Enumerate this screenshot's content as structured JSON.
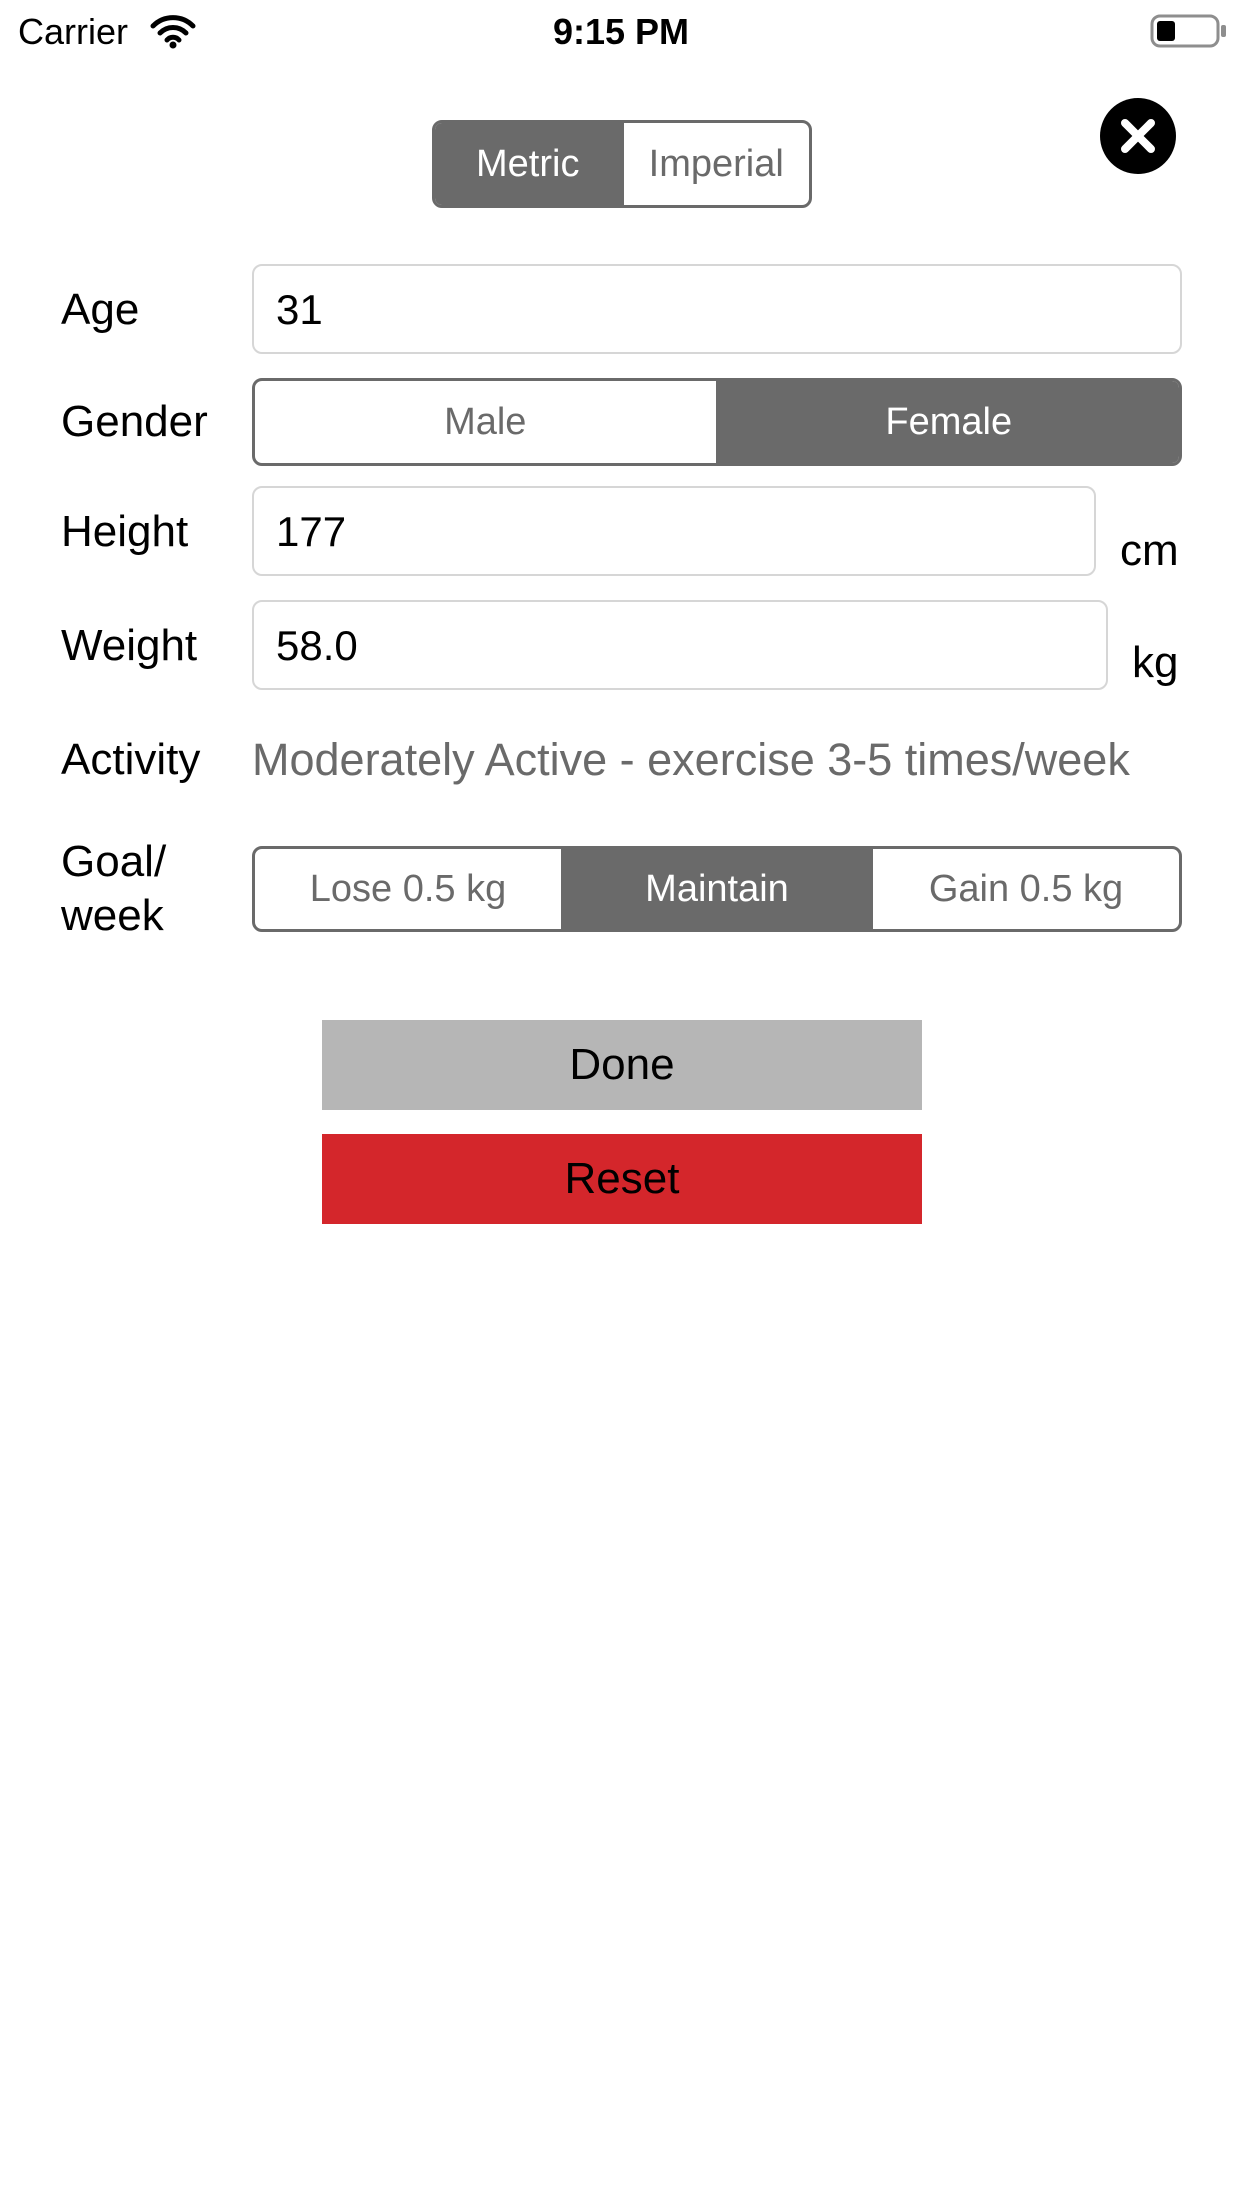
{
  "status_bar": {
    "carrier": "Carrier",
    "time": "9:15 PM",
    "icons": [
      "wifi-icon",
      "battery-icon"
    ]
  },
  "units": {
    "options": [
      "Metric",
      "Imperial"
    ],
    "selected": "Metric"
  },
  "close_icon": "close-icon",
  "form": {
    "age": {
      "label": "Age",
      "value": "31"
    },
    "gender": {
      "label": "Gender",
      "options": [
        "Male",
        "Female"
      ],
      "selected": "Female"
    },
    "height": {
      "label": "Height",
      "value": "177",
      "unit": "cm"
    },
    "weight": {
      "label": "Weight",
      "value": "58.0",
      "unit": "kg"
    },
    "activity": {
      "label": "Activity",
      "value": "Moderately Active - exercise 3-5 times/week"
    },
    "goal": {
      "label_line1": "Goal/",
      "label_line2": "week",
      "options": [
        "Lose 0.5 kg",
        "Maintain",
        "Gain 0.5 kg"
      ],
      "selected": "Maintain"
    }
  },
  "actions": {
    "done_label": "Done",
    "reset_label": "Reset"
  },
  "colors": {
    "segment_selected": "#6a6a6a",
    "done_button": "#b6b6b6",
    "reset_button": "#d4262b",
    "field_border": "#d6d6d6"
  }
}
